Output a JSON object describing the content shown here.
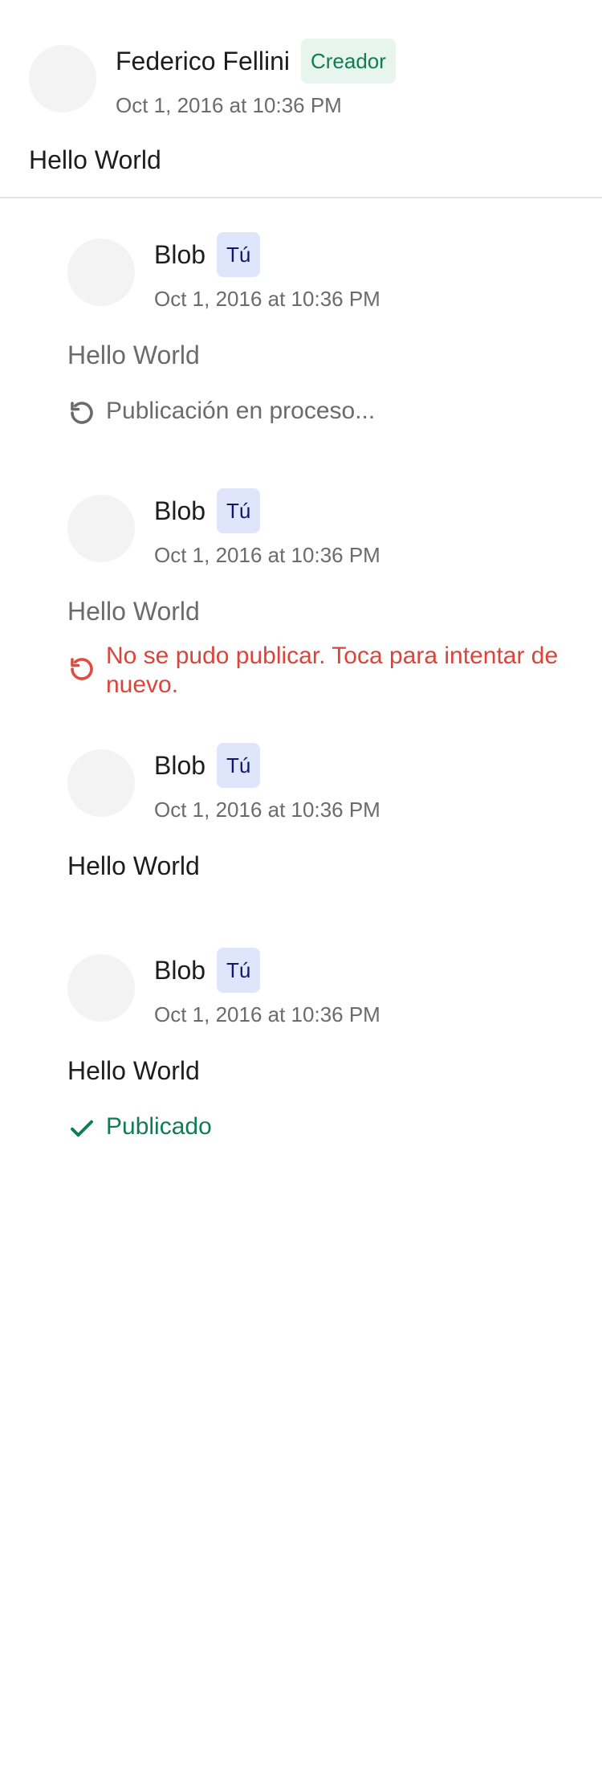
{
  "root_comment": {
    "author": "Federico Fellini",
    "badge": "Creador",
    "timestamp": "Oct 1, 2016 at 10:36 PM",
    "body": "Hello World"
  },
  "replies": [
    {
      "author": "Blob",
      "badge": "Tú",
      "timestamp": "Oct 1, 2016 at 10:36 PM",
      "body": "Hello World",
      "status": "Publicación en proceso...",
      "status_icon": "refresh-icon"
    },
    {
      "author": "Blob",
      "badge": "Tú",
      "timestamp": "Oct 1, 2016 at 10:36 PM",
      "body": "Hello World",
      "status": "No se pudo publicar. Toca para intentar de nuevo.",
      "status_icon": "retry-icon"
    },
    {
      "author": "Blob",
      "badge": "Tú",
      "timestamp": "Oct 1, 2016 at 10:36 PM",
      "body": "Hello World"
    },
    {
      "author": "Blob",
      "badge": "Tú",
      "timestamp": "Oct 1, 2016 at 10:36 PM",
      "body": "Hello World",
      "status": "Publicado",
      "status_icon": "checkmark-icon"
    }
  ],
  "colors": {
    "creator_badge_bg": "#e8f5ee",
    "creator_badge_text": "#0f7d53",
    "you_badge_bg": "#dfe6fc",
    "you_badge_text": "#0d1a66",
    "error": "#d9453b",
    "success": "#0f7d53",
    "muted": "#6b6b6b"
  }
}
